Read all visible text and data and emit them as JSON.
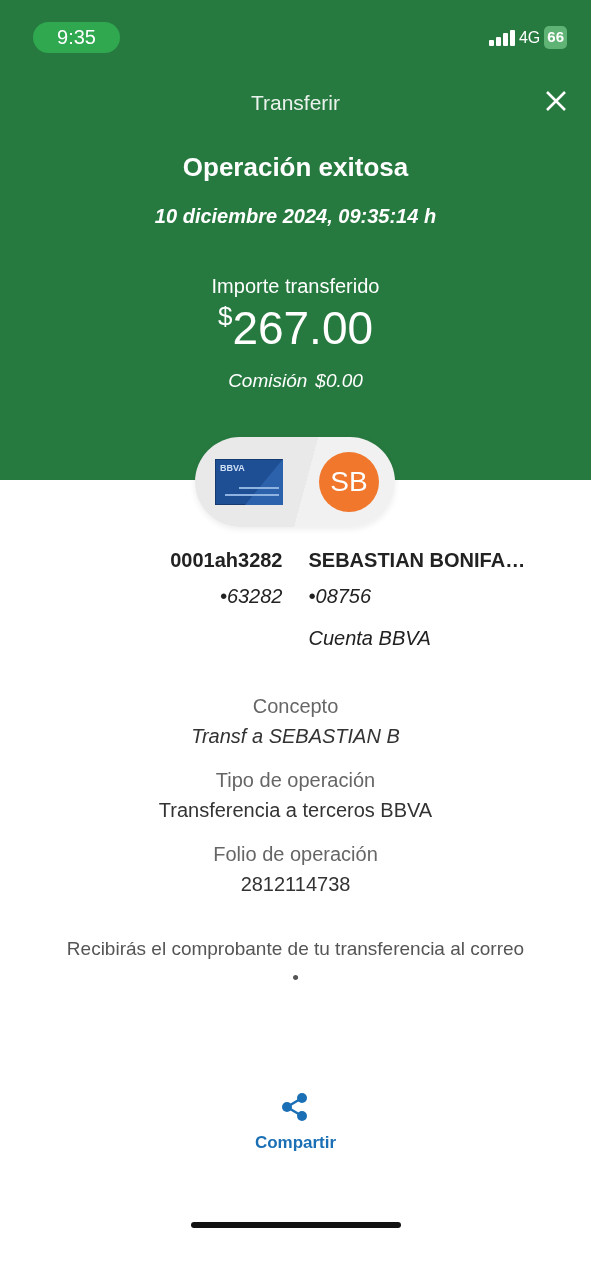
{
  "status_bar": {
    "time": "9:35",
    "network": "4G",
    "battery": "66"
  },
  "header": {
    "title": "Transferir"
  },
  "result": {
    "title": "Operación exitosa",
    "date": "10 diciembre 2024, 09:35:14 h",
    "amount_label": "Importe transferido",
    "currency": "$",
    "amount": "267.00",
    "commission_label": "Comisión",
    "commission": "$0.00"
  },
  "parties": {
    "card_brand": "BBVA",
    "avatar_initials": "SB",
    "origin": {
      "name": "0001ah3282",
      "account": "•63282"
    },
    "destination": {
      "name": "SEBASTIAN BONIFA…",
      "account": "•08756",
      "bank": "Cuenta BBVA"
    }
  },
  "details": [
    {
      "label": "Concepto",
      "value": "Transf a SEBASTIAN B",
      "italic": true
    },
    {
      "label": "Tipo de operación",
      "value": "Transferencia a terceros BBVA",
      "italic": false
    },
    {
      "label": "Folio de operación",
      "value": "2812114738",
      "italic": false
    }
  ],
  "notice": [
    "Recibirás el comprobante de tu transferencia al correo",
    "•"
  ],
  "share": {
    "label": "Compartir"
  }
}
